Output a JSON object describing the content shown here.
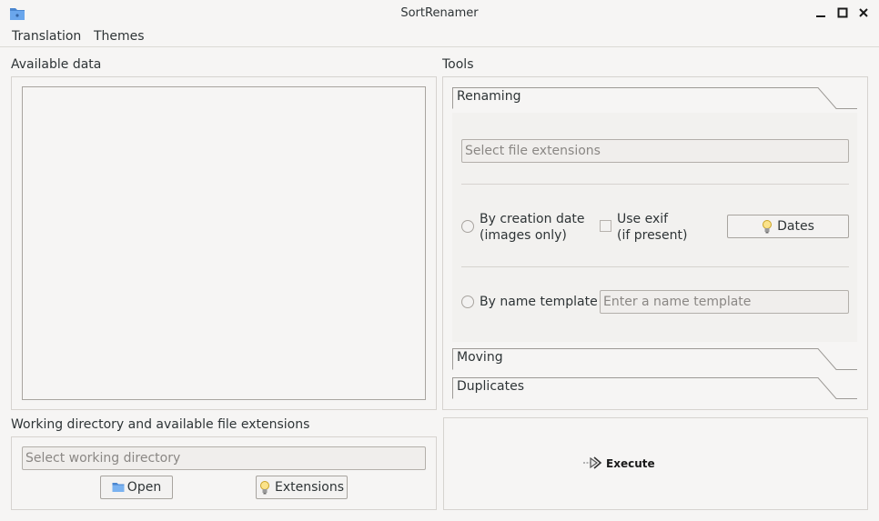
{
  "window": {
    "title": "SortRenamer"
  },
  "menu": {
    "items": [
      "Translation",
      "Themes"
    ]
  },
  "available_data": {
    "label": "Available data"
  },
  "tools": {
    "label": "Tools",
    "sections": {
      "renaming": "Renaming",
      "moving": "Moving",
      "duplicates": "Duplicates"
    },
    "renaming": {
      "extensions_placeholder": "Select file extensions",
      "by_creation_date_line1": "By creation date",
      "by_creation_date_line2": "(images only)",
      "use_exif_line1": "Use exif",
      "use_exif_line2": "(if present)",
      "dates_button": "Dates",
      "by_name_template": "By name template",
      "name_template_placeholder": "Enter a name template"
    }
  },
  "working_dir": {
    "label": "Working directory and available file extensions",
    "placeholder": "Select working directory",
    "open_button": "Open",
    "extensions_button": "Extensions"
  },
  "execute": {
    "label": "Execute"
  },
  "icons": {
    "app": "folder-icon",
    "open": "folder-icon",
    "extensions": "lightbulb-icon",
    "dates": "lightbulb-icon",
    "execute": "arrow-right-icon"
  }
}
